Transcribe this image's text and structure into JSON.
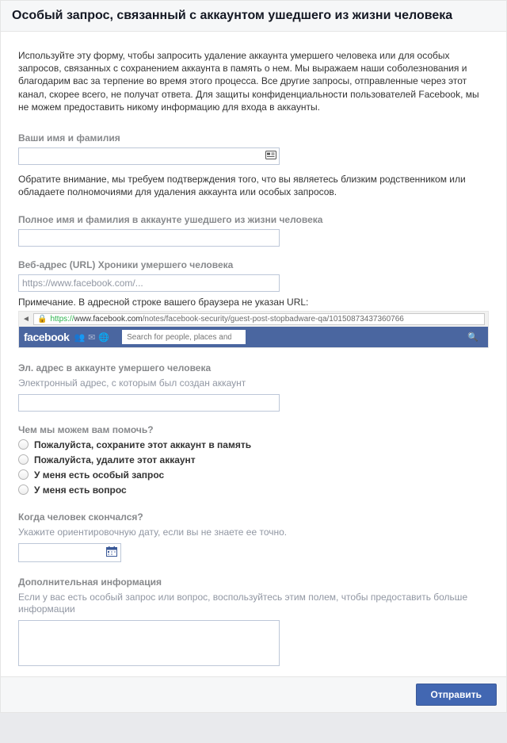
{
  "header": {
    "title": "Особый запрос, связанный с аккаунтом ушедшего из жизни человека"
  },
  "intro": "Используйте эту форму, чтобы запросить удаление аккаунта умершего человека или для особых запросов, связанных с сохранением аккаунта в память о нем. Мы выражаем наши соболезнования и благодарим вас за терпение во время этого процесса. Все другие запросы, отправленные через этот канал, скорее всего, не получат ответа. Для защиты конфиденциальности пользователей Facebook, мы не можем предоставить никому информацию для входа в аккаунты.",
  "your_name": {
    "label": "Ваши имя и фамилия",
    "value": ""
  },
  "your_name_note": "Обратите внимание, мы требуем подтверждения того, что вы являетесь близким родственником или обладаете полномочиями для удаления аккаунта или особых запросов.",
  "deceased_name": {
    "label": "Полное имя и фамилия в аккаунте ушедшего из жизни человека",
    "value": ""
  },
  "deceased_url": {
    "label": "Веб-адрес (URL) Хроники умершего человека",
    "placeholder": "https://www.facebook.com/..."
  },
  "url_note": "Примечание. В адресной строке вашего браузера не указан URL:",
  "url_demo": {
    "protocol": "https://",
    "domain": "www.facebook.com",
    "path": "/notes/facebook-security/guest-post-stopbadware-qa/10150873437360766",
    "fb_label": "facebook",
    "search_placeholder": "Search for people, places and things"
  },
  "deceased_email": {
    "label": "Эл. адрес в аккаунте умершего человека",
    "help": "Электронный адрес, с которым был создан аккаунт",
    "value": ""
  },
  "help_question": {
    "label": "Чем мы можем вам помочь?"
  },
  "help_options": [
    {
      "label": "Пожалуйста, сохраните этот аккаунт в память"
    },
    {
      "label": "Пожалуйста, удалите этот аккаунт"
    },
    {
      "label": "У меня есть особый запрос"
    },
    {
      "label": "У меня есть вопрос"
    }
  ],
  "passed_date": {
    "label": "Когда человек скончался?",
    "help": "Укажите ориентировочную дату, если вы не знаете ее точно."
  },
  "additional": {
    "label": "Дополнительная информация",
    "help": "Если у вас есть особый запрос или вопрос, воспользуйтесь этим полем, чтобы предоставить больше информации",
    "value": ""
  },
  "submit": {
    "label": "Отправить"
  }
}
